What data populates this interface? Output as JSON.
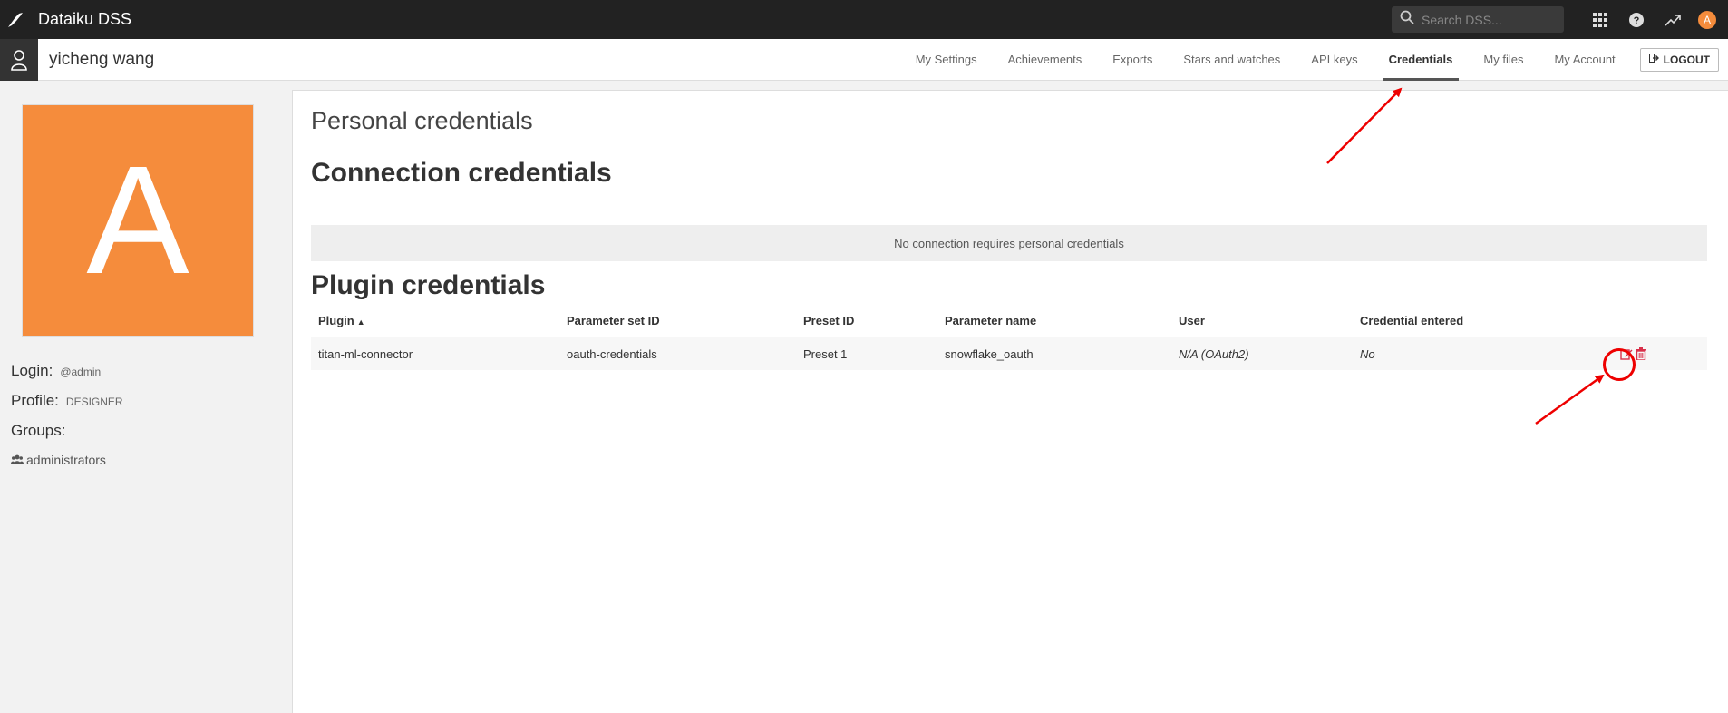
{
  "topbar": {
    "app_title": "Dataiku DSS",
    "search_placeholder": "Search DSS...",
    "avatar_letter": "A"
  },
  "user": {
    "name": "yicheng wang",
    "avatar_letter": "A",
    "login_label": "Login:",
    "login_value": "@admin",
    "profile_label": "Profile:",
    "profile_value": "DESIGNER",
    "groups_label": "Groups:",
    "groups": [
      "administrators"
    ]
  },
  "nav": {
    "tabs": [
      {
        "label": "My Settings"
      },
      {
        "label": "Achievements"
      },
      {
        "label": "Exports"
      },
      {
        "label": "Stars and watches"
      },
      {
        "label": "API keys"
      },
      {
        "label": "Credentials",
        "active": true
      },
      {
        "label": "My files"
      },
      {
        "label": "My Account"
      }
    ],
    "logout_label": "LOGOUT"
  },
  "main": {
    "page_title": "Personal credentials",
    "connection_title": "Connection credentials",
    "connection_empty": "No connection requires personal credentials",
    "plugin_title": "Plugin credentials",
    "table": {
      "headers": [
        "Plugin",
        "Parameter set ID",
        "Preset ID",
        "Parameter name",
        "User",
        "Credential entered"
      ],
      "rows": [
        [
          "titan-ml-connector",
          "oauth-credentials",
          "Preset 1",
          "snowflake_oauth",
          "N/A (OAuth2)",
          "No"
        ]
      ]
    }
  },
  "colors": {
    "topbar": "#222222",
    "avatar": "#f58c3c",
    "annotation": "#e00000",
    "action_icon": "#d9304a"
  }
}
